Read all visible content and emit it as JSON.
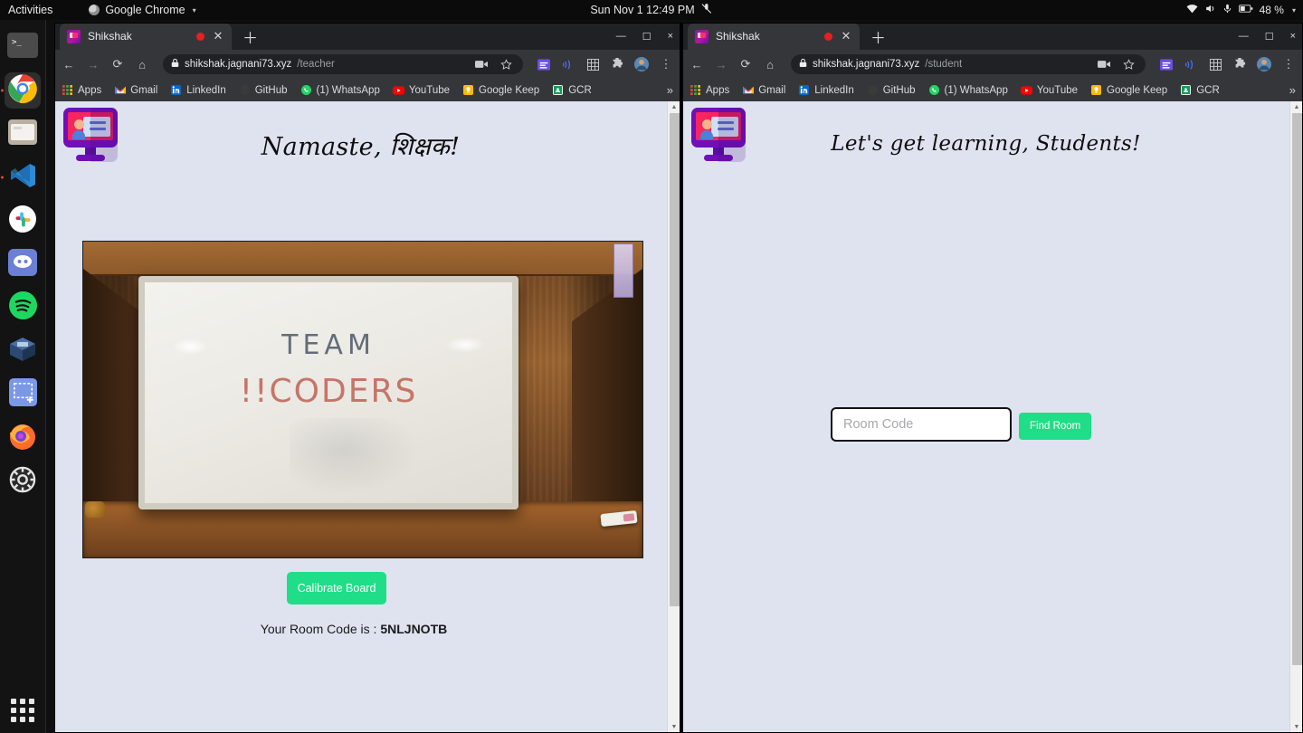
{
  "desktop": {
    "topbar": {
      "activities": "Activities",
      "app_menu": "Google Chrome",
      "app_menu_icon": "chrome-circle-icon",
      "clock": "Sun Nov 1  12:49 PM",
      "mute_icon": "microphone-muted-icon",
      "wifi_icon": "wifi-icon",
      "volume_icon": "volume-icon",
      "mic_icon": "microphone-icon",
      "battery_icon": "battery-icon",
      "battery_label": "48 %",
      "menu_caret_icon": "chevron-down-icon"
    },
    "dock": {
      "items": [
        {
          "name": "terminal",
          "icon": "terminal-icon"
        },
        {
          "name": "google-chrome",
          "icon": "chrome-icon"
        },
        {
          "name": "files",
          "icon": "files-folder-icon"
        },
        {
          "name": "visual-studio-code",
          "icon": "vscode-icon"
        },
        {
          "name": "slack",
          "icon": "slack-icon"
        },
        {
          "name": "discord",
          "icon": "discord-icon"
        },
        {
          "name": "spotify",
          "icon": "spotify-icon"
        },
        {
          "name": "virtualbox",
          "icon": "virtualbox-icon"
        },
        {
          "name": "screenshot",
          "icon": "screenshot-icon"
        },
        {
          "name": "firefox",
          "icon": "firefox-icon"
        },
        {
          "name": "settings",
          "icon": "gear-icon"
        }
      ],
      "show_apps_icon": "apps-grid-icon"
    }
  },
  "windows": [
    {
      "id": "teacher",
      "tab": {
        "title": "Shikshak",
        "favicon": "shikshak-monitor-favicon",
        "recording_icon": "recording-dot-icon",
        "close_icon": "close-icon",
        "new_tab_icon": "plus-icon"
      },
      "window_controls": {
        "minimize": "—",
        "maximize": "☐",
        "close": "×"
      },
      "toolbar": {
        "back_icon": "arrow-left-icon",
        "forward_icon": "arrow-right-icon",
        "reload_icon": "reload-icon",
        "home_icon": "home-icon",
        "lock_icon": "lock-icon",
        "url_domain": "shikshak.jagnani73.xyz",
        "url_path": "/teacher",
        "cast_icon": "video-camera-icon",
        "bookmark_icon": "star-icon",
        "extensions": [
          "reading-list-icon",
          "cast-audio-icon",
          "grid-extension-icon",
          "puzzle-extension-icon"
        ],
        "profile_icon": "avatar-icon",
        "menu_icon": "three-dot-menu-icon"
      },
      "bookmarks": {
        "items": [
          {
            "label": "Apps",
            "icon": "apps-grid-icon"
          },
          {
            "label": "Gmail",
            "icon": "gmail-icon"
          },
          {
            "label": "LinkedIn",
            "icon": "linkedin-icon"
          },
          {
            "label": "GitHub",
            "icon": "github-icon"
          },
          {
            "label": "(1) WhatsApp",
            "icon": "whatsapp-icon"
          },
          {
            "label": "YouTube",
            "icon": "youtube-icon"
          },
          {
            "label": "Google Keep",
            "icon": "keep-icon"
          },
          {
            "label": "GCR",
            "icon": "classroom-icon"
          }
        ],
        "overflow": "»"
      },
      "page": {
        "logo_icon": "shikshak-logo-icon",
        "greeting": "Namaste, शिक्षक!",
        "video_feed": {
          "name": "whiteboard-camera-feed",
          "board_line_1": "TEAM",
          "board_line_2": "!!CODERS"
        },
        "calibrate_label": "Calibrate Board",
        "room_code_prefix": "Your Room Code is : ",
        "room_code": "5NLJNOTB"
      }
    },
    {
      "id": "student",
      "tab": {
        "title": "Shikshak",
        "favicon": "shikshak-monitor-favicon",
        "recording_icon": "recording-dot-icon",
        "close_icon": "close-icon",
        "new_tab_icon": "plus-icon"
      },
      "window_controls": {
        "minimize": "—",
        "maximize": "☐",
        "close": "×"
      },
      "toolbar": {
        "back_icon": "arrow-left-icon",
        "forward_icon": "arrow-right-icon",
        "reload_icon": "reload-icon",
        "home_icon": "home-icon",
        "lock_icon": "lock-icon",
        "url_domain": "shikshak.jagnani73.xyz",
        "url_path": "/student",
        "cast_icon": "video-camera-icon",
        "bookmark_icon": "star-icon",
        "extensions": [
          "reading-list-icon",
          "cast-audio-icon",
          "grid-extension-icon",
          "puzzle-extension-icon"
        ],
        "profile_icon": "avatar-icon",
        "menu_icon": "three-dot-menu-icon"
      },
      "bookmarks": {
        "items": [
          {
            "label": "Apps",
            "icon": "apps-grid-icon"
          },
          {
            "label": "Gmail",
            "icon": "gmail-icon"
          },
          {
            "label": "LinkedIn",
            "icon": "linkedin-icon"
          },
          {
            "label": "GitHub",
            "icon": "github-icon"
          },
          {
            "label": "(1) WhatsApp",
            "icon": "whatsapp-icon"
          },
          {
            "label": "YouTube",
            "icon": "youtube-icon"
          },
          {
            "label": "Google Keep",
            "icon": "keep-icon"
          },
          {
            "label": "GCR",
            "icon": "classroom-icon"
          }
        ],
        "overflow": "»"
      },
      "page": {
        "logo_icon": "shikshak-logo-icon",
        "greeting": "Let's get learning, Students!",
        "room_code_placeholder": "Room Code",
        "room_code_value": "",
        "find_room_label": "Find Room"
      }
    }
  ],
  "colors": {
    "page_background": "#dfe3f0",
    "accent_green": "#1fde87",
    "chrome_toolbar": "#35363a",
    "chrome_titlebar": "#202124",
    "logo_purple": "#6f10b8",
    "logo_pink": "#f8265f"
  }
}
